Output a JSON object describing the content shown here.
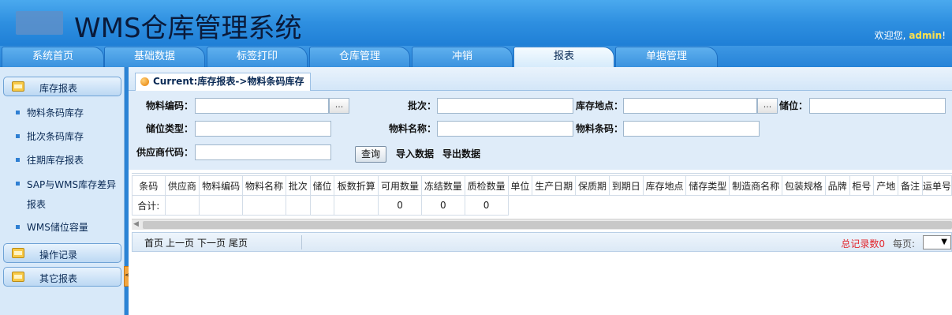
{
  "header": {
    "title": "WMS仓库管理系统",
    "welcome_prefix": "欢迎您,",
    "user": "admin",
    "welcome_suffix": "!"
  },
  "nav": {
    "tabs": [
      {
        "label": "系统首页"
      },
      {
        "label": "基础数据"
      },
      {
        "label": "标签打印"
      },
      {
        "label": "仓库管理"
      },
      {
        "label": "冲销"
      },
      {
        "label": "报表"
      },
      {
        "label": "单据管理"
      }
    ],
    "active": "报表"
  },
  "sidebar": {
    "groups": [
      {
        "label": "库存报表"
      },
      {
        "label": "操作记录"
      },
      {
        "label": "其它报表"
      }
    ],
    "items": [
      {
        "label": "物料条码库存"
      },
      {
        "label": "批次条码库存"
      },
      {
        "label": "往期库存报表"
      },
      {
        "label": "SAP与WMS库存差异报表"
      },
      {
        "label": "WMS储位容量"
      }
    ],
    "collapse_glyph": "<"
  },
  "breadcrumb": "Current:库存报表->物料条码库存",
  "form": {
    "material_code_label": "物料编码：",
    "batch_label": "批次：",
    "location_label": "库存地点：",
    "bin_label": "储位：",
    "bin_type_label": "储位类型：",
    "material_name_label": "物料名称：",
    "material_barcode_label": "物料条码：",
    "supplier_code_label": "供应商代码：",
    "dots": "...",
    "query_button": "查询",
    "import_link": "导入数据",
    "export_link": "导出数据",
    "values": {
      "material_code": "",
      "batch": "",
      "location": "",
      "bin": "",
      "bin_type": "",
      "material_name": "",
      "material_barcode": "",
      "supplier_code": ""
    }
  },
  "grid": {
    "columns": [
      "条码",
      "供应商",
      "物料编码",
      "物料名称",
      "批次",
      "储位",
      "板数折算",
      "可用数量",
      "冻结数量",
      "质检数量",
      "单位",
      "生产日期",
      "保质期",
      "到期日",
      "库存地点",
      "储存类型",
      "制造商名称",
      "包装规格",
      "品牌",
      "柜号",
      "产地",
      "备注",
      "运单号"
    ],
    "total_row": {
      "label": "合计:",
      "available_qty": "0",
      "frozen_qty": "0",
      "qc_qty": "0"
    }
  },
  "pager": {
    "first": "首页",
    "prev": "上一页",
    "next": "下一页",
    "last": "尾页",
    "total_records": "总记录数0",
    "page_size_label": "每页:",
    "page_size_value": ""
  },
  "colors": {
    "header_blue": "#2e8fe0",
    "sidebar_bg": "#d8e9f9",
    "total_red": "#e3242b",
    "username_yellow": "#ffe14d"
  }
}
